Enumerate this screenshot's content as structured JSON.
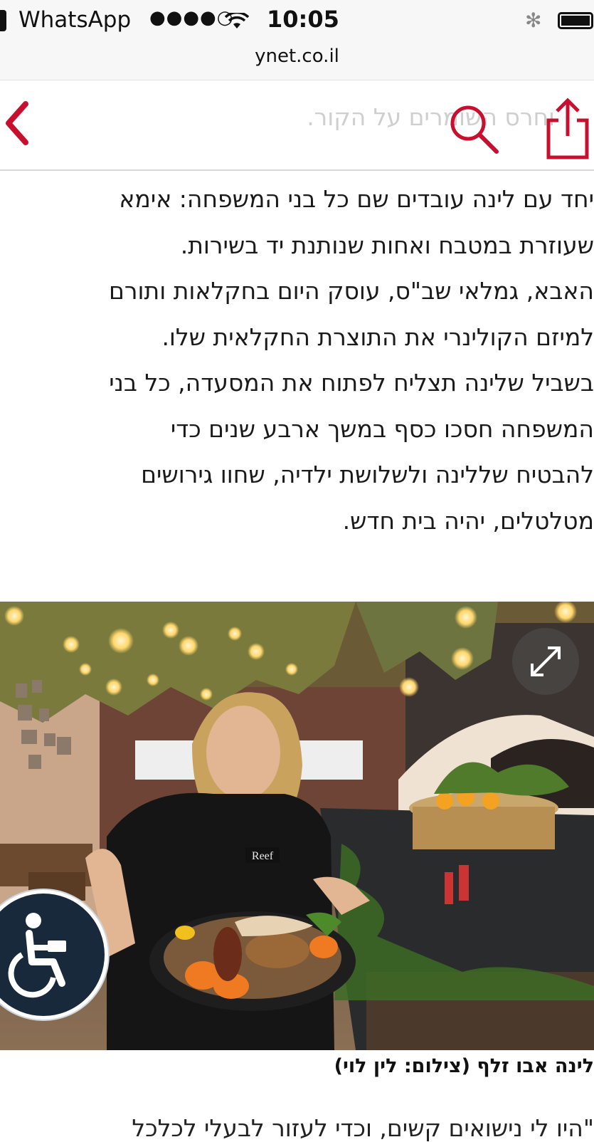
{
  "status_bar": {
    "carrier": "WhatsApp",
    "signal": "●●●●○",
    "time": "10:05",
    "bluetooth": "✻"
  },
  "browser": {
    "url": "ynet.co.il"
  },
  "header": {
    "back_icon": "chevron-left-icon",
    "search_icon": "search-icon",
    "share_icon": "share-icon",
    "accent_color": "#c8102e",
    "faded_teaser": "וחרס השומרים על הקור."
  },
  "article": {
    "paragraph_lines": [
      "יחד עם לינה עובדים שם כל בני המשפחה: אימא",
      "שעוזרת במטבח ואחות שנותנת יד בשירות.",
      "האבא, גמלאי שב\"ס, עוסק היום בחקלאות ותורם",
      "למיזם הקולינרי את התוצרת החקלאית שלו.",
      "בשביל שלינה תצליח לפתוח את המסעדה, כל בני",
      "המשפחה חסכו כסף במשך ארבע שנים כדי",
      "להבטיח שללינה ולשלושת ילדיה, שחוו גירושים",
      "מטלטלים, יהיה בית חדש."
    ]
  },
  "photo": {
    "expand_icon": "expand-icon",
    "accessibility_icon": "wheelchair-accessibility-icon",
    "apron_logo": "Reef"
  },
  "caption": "לינה אבו זלף (צילום: לין לוי)",
  "next_line": "\"היו לי נישואים קשים, וכדי לעזור לבעלי לכלכל"
}
